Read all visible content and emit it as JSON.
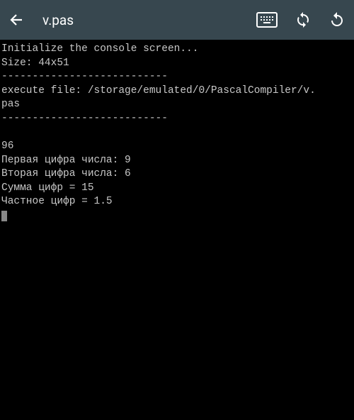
{
  "toolbar": {
    "title": "v.pas"
  },
  "console": {
    "lines": [
      "Initialize the console screen...",
      "Size: 44x51",
      "---------------------------",
      "execute file: /storage/emulated/0/PascalCompiler/v.",
      "pas",
      "---------------------------",
      "",
      "96",
      "Первая цифра числа: 9",
      "Вторая цифра числа: 6",
      "Сумма цифр = 15",
      "Частное цифр = 1.5"
    ]
  }
}
